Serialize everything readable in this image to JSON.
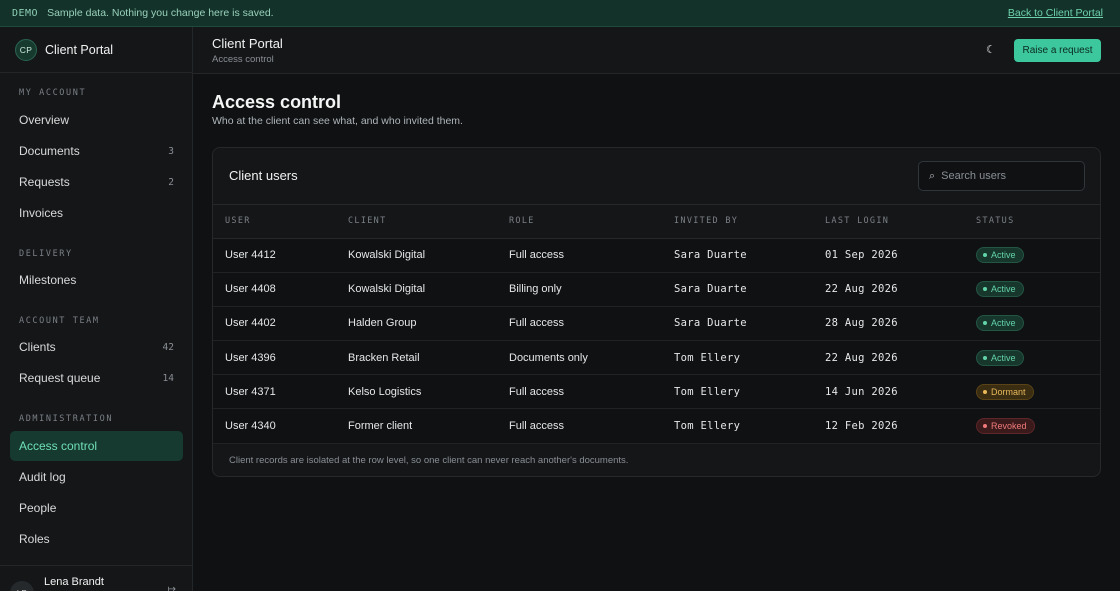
{
  "banner": {
    "tag": "DEMO",
    "message": "Sample data. Nothing you change here is saved.",
    "back_link": "Back to Client Portal"
  },
  "brand": {
    "badge": "CP",
    "name": "Client Portal"
  },
  "sidebar": {
    "sections": [
      {
        "label": "MY ACCOUNT"
      },
      {
        "label": "DELIVERY"
      },
      {
        "label": "ACCOUNT TEAM"
      },
      {
        "label": "ADMINISTRATION"
      }
    ],
    "items": [
      {
        "label": "Overview",
        "count": ""
      },
      {
        "label": "Documents",
        "count": "3"
      },
      {
        "label": "Requests",
        "count": "2"
      },
      {
        "label": "Invoices",
        "count": ""
      },
      {
        "label": "Milestones",
        "count": ""
      },
      {
        "label": "Clients",
        "count": "42"
      },
      {
        "label": "Request queue",
        "count": "14"
      },
      {
        "label": "Access control",
        "count": ""
      },
      {
        "label": "Audit log",
        "count": ""
      },
      {
        "label": "People",
        "count": ""
      },
      {
        "label": "Roles",
        "count": ""
      }
    ],
    "footer": {
      "initials": "LB",
      "name": "Lena Brandt"
    }
  },
  "header": {
    "title": "Client Portal",
    "subtitle": "Access control",
    "raise_button": "Raise a request"
  },
  "main": {
    "title": "Access control",
    "subtitle": "Who at the client can see what, and who invited them.",
    "card_title": "Client users",
    "search_placeholder": "Search users",
    "columns": [
      "USER",
      "CLIENT",
      "ROLE",
      "INVITED BY",
      "LAST LOGIN",
      "STATUS"
    ],
    "rows": [
      {
        "user": "User 4412",
        "client": "Kowalski Digital",
        "role": "Full access",
        "invited_by": "Sara Duarte",
        "last_login": "01 Sep 2026",
        "status": "Active"
      },
      {
        "user": "User 4408",
        "client": "Kowalski Digital",
        "role": "Billing only",
        "invited_by": "Sara Duarte",
        "last_login": "22 Aug 2026",
        "status": "Active"
      },
      {
        "user": "User 4402",
        "client": "Halden Group",
        "role": "Full access",
        "invited_by": "Sara Duarte",
        "last_login": "28 Aug 2026",
        "status": "Active"
      },
      {
        "user": "User 4396",
        "client": "Bracken Retail",
        "role": "Documents only",
        "invited_by": "Tom Ellery",
        "last_login": "22 Aug 2026",
        "status": "Active"
      },
      {
        "user": "User 4371",
        "client": "Kelso Logistics",
        "role": "Full access",
        "invited_by": "Tom Ellery",
        "last_login": "14 Jun 2026",
        "status": "Dormant"
      },
      {
        "user": "User 4340",
        "client": "Former client",
        "role": "Full access",
        "invited_by": "Tom Ellery",
        "last_login": "12 Feb 2026",
        "status": "Revoked"
      }
    ],
    "footnote": "Client records are isolated at the row level, so one client can never reach another's documents."
  },
  "colors": {
    "accent": "#3cc79c",
    "active": "#63d3a9",
    "dormant": "#e9b85a",
    "revoked": "#ef7a7a"
  }
}
